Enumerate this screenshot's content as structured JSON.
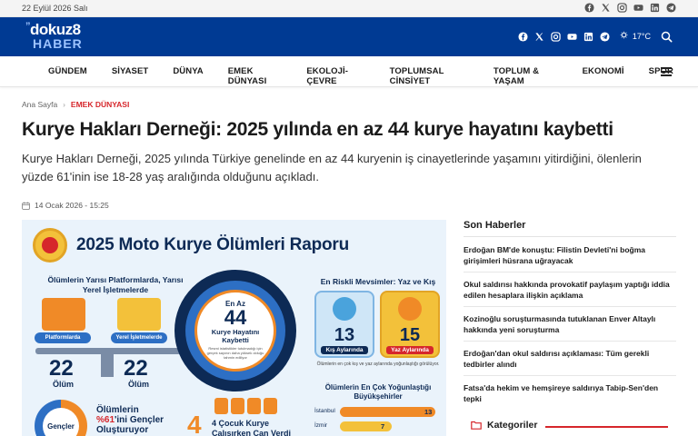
{
  "topbar": {
    "date": "22 Eylül 2026 Salı"
  },
  "header": {
    "logo_top": "dokuz8",
    "logo_bottom": "HABER",
    "temperature": "17°C"
  },
  "icons": [
    "facebook-icon",
    "x-icon",
    "instagram-icon",
    "youtube-icon",
    "linkedin-icon",
    "telegram-icon",
    "weather-icon",
    "search-icon",
    "hamburger-icon"
  ],
  "nav": {
    "items": [
      "GÜNDEM",
      "SİYASET",
      "DÜNYA",
      "EMEK DÜNYASI",
      "EKOLOJİ-ÇEVRE",
      "TOPLUMSAL CİNSİYET",
      "TOPLUM & YAŞAM",
      "EKONOMİ",
      "SPOR"
    ]
  },
  "breadcrumb": {
    "home": "Ana Sayfa",
    "category": "EMEK DÜNYASI"
  },
  "article": {
    "title": "Kurye Hakları Derneği: 2025 yılında en az 44 kurye hayatını kaybetti",
    "lead": "Kurye Hakları Derneği, 2025 yılında Türkiye genelinde en az 44 kuryenin iş cinayetlerinde yaşamını yitirdiğini, ölenlerin yüzde 61'inin ise 18-28 yaş aralığında olduğunu açıkladı.",
    "date": "14 Ocak 2026 - 15:25"
  },
  "infographic": {
    "title": "2025 Moto Kurye Ölümleri Raporu",
    "half_title": "Ölümlerin Yarısı Platformlarda, Yarısı Yerel İşletmelerde",
    "platform_label": "Platformlarda",
    "local_label": "Yerel İşletmelerde",
    "platform_count": "22",
    "local_count": "22",
    "death_word": "Ölüm",
    "center_top": "En Az",
    "center_num": "44",
    "center_label": "Kurye Hayatını Kaybetti",
    "center_note": "Resmi istatistikler tutulmadığı için gerçek sayının daha yüksek olduğu tahmin ediliyor",
    "season_title": "En Riskli Mevsimler: Yaz ve Kış",
    "winter_num": "13",
    "winter_label": "Kış Aylarında",
    "summer_num": "15",
    "summer_label": "Yaz Aylarında",
    "season_note": "Ölümlerin en çok kış ve yaz aylarında yoğunlaştığı görülüyor.",
    "young_badge": "Gençler",
    "young_line1": "Ölümlerin",
    "young_line2_pct": "%61",
    "young_line2_rest": "'ini Gençler",
    "young_line3": "Oluşturuyor",
    "kids_num": "4",
    "kids_text1": "4 Çocuk Kurye",
    "kids_text2": "Çalışırken Can Verdi",
    "city_title": "Ölümlerin En Çok Yoğunlaştığı Büyükşehirler",
    "cities": [
      {
        "name": "İstanbul",
        "value": 13
      },
      {
        "name": "İzmir",
        "value": 7
      }
    ]
  },
  "sidebar": {
    "title": "Son Haberler",
    "news": [
      "Erdoğan BM'de konuştu: Filistin Devleti'ni boğma girişimleri hüsrana uğrayacak",
      "Okul saldırısı hakkında provokatif paylaşım yaptığı iddia edilen hesaplara ilişkin açıklama",
      "Kozinoğlu soruşturmasında tutuklanan Enver Altaylı hakkında yeni soruşturma",
      "Erdoğan'dan okul saldırısı açıklaması: Tüm gerekli tedbirler alındı",
      "Fatsa'da hekim ve hemşireye saldırıya Tabip-Sen'den tepki"
    ],
    "categories": "Kategoriler"
  },
  "colors": {
    "brand": "#003a93",
    "accent": "#d6262b",
    "orange": "#f08a27",
    "yellow": "#f3c13a"
  }
}
